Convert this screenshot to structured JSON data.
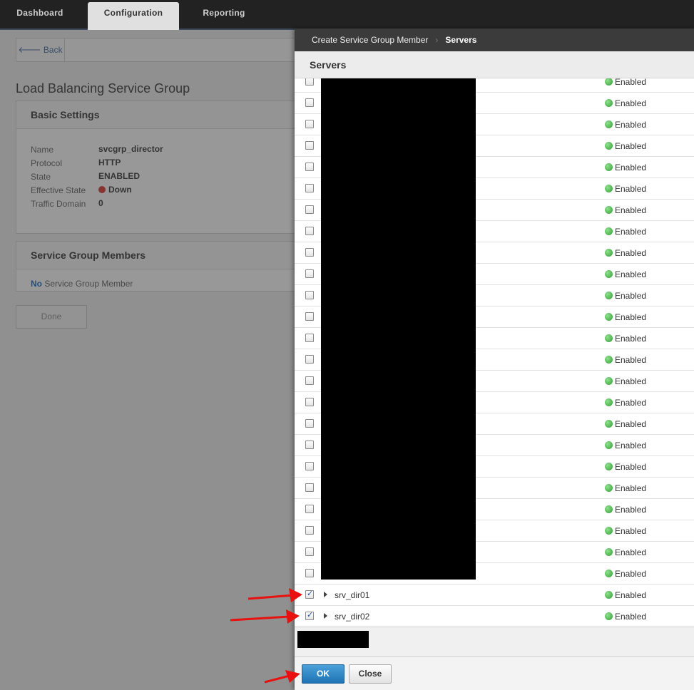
{
  "nav": {
    "tabs": [
      {
        "label": "Dashboard"
      },
      {
        "label": "Configuration"
      },
      {
        "label": "Reporting"
      }
    ]
  },
  "background": {
    "back_label": "Back",
    "page_title": "Load Balancing Service Group",
    "basic_settings": {
      "title": "Basic Settings",
      "fields": [
        {
          "label": "Name",
          "value": "svcgrp_director"
        },
        {
          "label": "Protocol",
          "value": "HTTP"
        },
        {
          "label": "State",
          "value": "ENABLED"
        },
        {
          "label": "Effective State",
          "value": "Down"
        },
        {
          "label": "Traffic Domain",
          "value": "0"
        }
      ]
    },
    "members": {
      "title": "Service Group Members",
      "empty_prefix": "No",
      "empty_suffix": "Service Group Member"
    },
    "done_label": "Done"
  },
  "dialog": {
    "breadcrumb": {
      "parent": "Create Service Group Member",
      "current": "Servers"
    },
    "subtitle": "Servers",
    "status_label": "Enabled",
    "servers": [
      {
        "name": "",
        "checked": false
      },
      {
        "name": "",
        "checked": false
      },
      {
        "name": "",
        "checked": false
      },
      {
        "name": "",
        "checked": false
      },
      {
        "name": "",
        "checked": false
      },
      {
        "name": "",
        "checked": false
      },
      {
        "name": "",
        "checked": false
      },
      {
        "name": "",
        "checked": false
      },
      {
        "name": "",
        "checked": false
      },
      {
        "name": "",
        "checked": false
      },
      {
        "name": "",
        "checked": false
      },
      {
        "name": "",
        "checked": false
      },
      {
        "name": "",
        "checked": false
      },
      {
        "name": "",
        "checked": false
      },
      {
        "name": "",
        "checked": false
      },
      {
        "name": "",
        "checked": false
      },
      {
        "name": "",
        "checked": false
      },
      {
        "name": "",
        "checked": false
      },
      {
        "name": "",
        "checked": false
      },
      {
        "name": "",
        "checked": false
      },
      {
        "name": "",
        "checked": false
      },
      {
        "name": "",
        "checked": false
      },
      {
        "name": "",
        "checked": false
      },
      {
        "name": "",
        "checked": false
      },
      {
        "name": "srv_dir01",
        "checked": true
      },
      {
        "name": "srv_dir02",
        "checked": true
      }
    ],
    "ok_label": "OK",
    "close_label": "Close"
  },
  "colors": {
    "accent": "#1f74b5",
    "enabled_green": "#2f9e2f",
    "down_red": "#d9534f",
    "annotation_arrow": "#e8110f"
  }
}
